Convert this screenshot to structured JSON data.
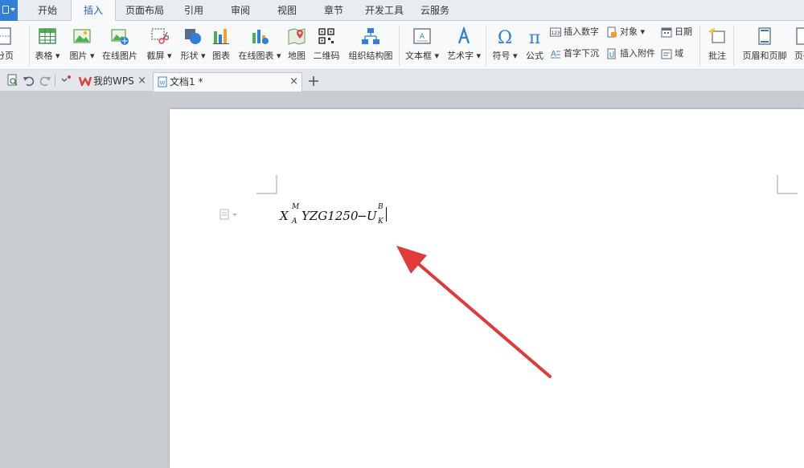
{
  "menu": {
    "tabs": [
      "开始",
      "插入",
      "页面布局",
      "引用",
      "审阅",
      "视图",
      "章节",
      "开发工具",
      "云服务"
    ],
    "active_tab": "插入"
  },
  "ribbon": {
    "cut_page": "分页",
    "table": "表格",
    "picture": "图片",
    "online_picture": "在线图片",
    "screenshot": "截屏",
    "shape": "形状",
    "chart": "图表",
    "online_chart": "在线图表",
    "map": "地图",
    "qrcode": "二维码",
    "org_chart": "组织结构图",
    "textbox": "文本框",
    "wordart": "艺术字",
    "symbol": "符号",
    "formula": "公式",
    "insert_number": "插入数字",
    "drop_cap": "首字下沉",
    "object": "对象",
    "insert_attachment": "插入附件",
    "date": "日期",
    "field": "域",
    "comment": "批注",
    "header_footer": "页眉和页脚",
    "page_number": "页码"
  },
  "tabs": {
    "home": "我的WPS",
    "doc": "文档1 *"
  },
  "document": {
    "formula": {
      "x": "X",
      "x_sup": "M",
      "x_sub": "A",
      "body": "YZG1250",
      "minus": "−",
      "u": "U",
      "u_sup": "B",
      "u_sub": "K"
    }
  },
  "colors": {
    "accent": "#2a63b8",
    "arrow": "#e03a3a",
    "app_button": "#2f7fd8"
  }
}
